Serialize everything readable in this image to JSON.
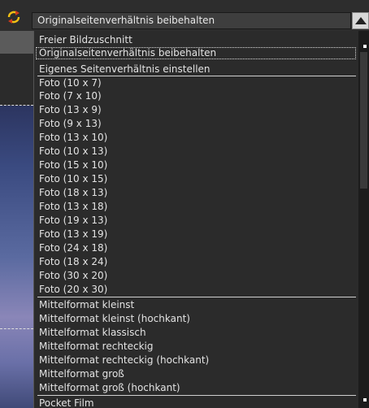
{
  "combo": {
    "selected_value": "Originalseitenverhältnis beibehalten"
  },
  "icons": {
    "rotate": "rotate-arrows-icon",
    "dropdown": "triangle-up-icon"
  },
  "colors": {
    "rotate_icon_accent": "#f2c014",
    "rotate_icon_red": "#d23a1a"
  },
  "list": {
    "items": [
      "Freier Bildzuschnitt",
      "Originalseitenverhältnis beibehalten",
      "Eigenes Seitenverhältnis einstellen",
      "Foto (10 x 7)",
      "Foto (7 x 10)",
      "Foto (13 x 9)",
      "Foto (9 x 13)",
      "Foto (13 x 10)",
      "Foto (10 x 13)",
      "Foto (15 x 10)",
      "Foto (10 x 15)",
      "Foto (18 x 13)",
      "Foto (13 x 18)",
      "Foto (19 x 13)",
      "Foto (13 x 19)",
      "Foto (24 x 18)",
      "Foto (18 x 24)",
      "Foto (30 x 20)",
      "Foto (20 x 30)",
      "Mittelformat kleinst",
      "Mittelformat kleinst (hochkant)",
      "Mittelformat klassisch",
      "Mittelformat rechteckig",
      "Mittelformat rechteckig (hochkant)",
      "Mittelformat groß",
      "Mittelformat groß (hochkant)",
      "Pocket Film"
    ]
  }
}
